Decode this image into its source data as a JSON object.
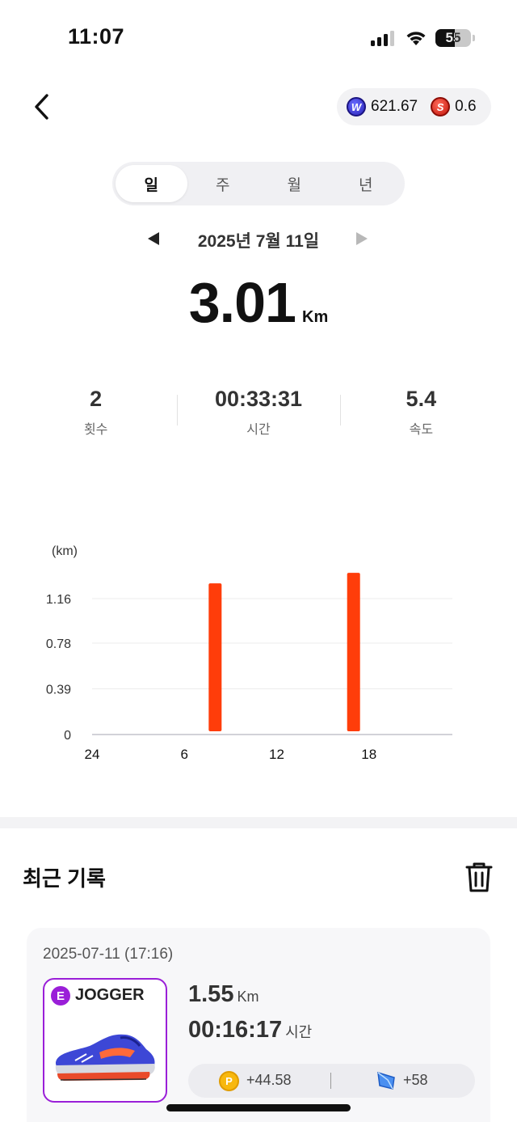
{
  "status_bar": {
    "time": "11:07",
    "battery": "55"
  },
  "header": {
    "back_icon": "chevron-left-icon",
    "coin_w_value": "621.67",
    "coin_s_value": "0.6",
    "colors": {
      "coin_w": "#2a24b8",
      "coin_s": "#c4160b"
    }
  },
  "period_tabs": [
    {
      "label": "일",
      "active": true
    },
    {
      "label": "주",
      "active": false
    },
    {
      "label": "월",
      "active": false
    },
    {
      "label": "년",
      "active": false
    }
  ],
  "date_nav": {
    "label": "2025년 7월 11일"
  },
  "total": {
    "value": "3.01",
    "unit": "Km"
  },
  "stats": [
    {
      "value": "2",
      "label": "횟수"
    },
    {
      "value": "00:33:31",
      "label": "시간"
    },
    {
      "value": "5.4",
      "label": "속도"
    }
  ],
  "chart_data": {
    "type": "bar",
    "ylabel": "(km)",
    "y_ticks": [
      "0",
      "0.39",
      "0.78",
      "1.16"
    ],
    "y_tick_values": [
      0,
      0.39,
      0.78,
      1.16
    ],
    "x_ticks": [
      "24",
      "6",
      "12",
      "18"
    ],
    "x_tick_hours": [
      0,
      6,
      12,
      18
    ],
    "x_range": [
      0,
      24
    ],
    "ylim": [
      0,
      1.16
    ],
    "grid": true,
    "bar_color": "#ff3d0a",
    "bars": [
      {
        "hour": 8,
        "value": 1.29
      },
      {
        "hour": 17,
        "value": 1.38
      }
    ]
  },
  "recent": {
    "title": "최근 기록",
    "trash_icon": "trash-icon",
    "records": [
      {
        "date": "2025-07-11 (17:16)",
        "grade": "E",
        "shoe_type": "JOGGER",
        "distance": "1.55",
        "distance_unit": "Km",
        "time": "00:16:17",
        "time_unit": "시간",
        "reward_points": "+44.58",
        "reward_map": "+58",
        "colors": {
          "border": "#9a1fd8",
          "points": "#f8b80f"
        }
      }
    ]
  }
}
